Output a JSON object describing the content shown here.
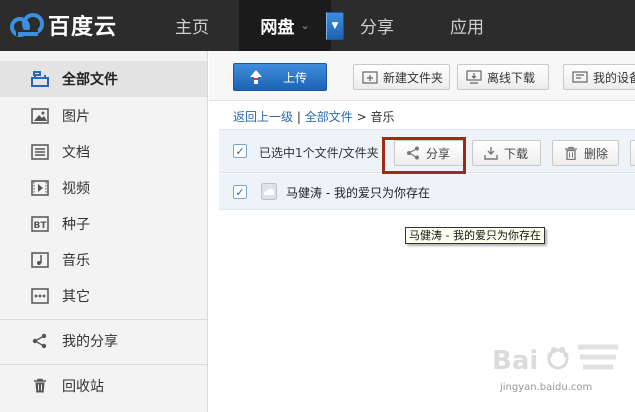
{
  "brand": {
    "name": "百度云"
  },
  "nav": [
    {
      "label": "主页",
      "active": false
    },
    {
      "label": "网盘",
      "active": true,
      "chevron": "chevron-down-icon"
    },
    {
      "label": "分享",
      "active": false
    },
    {
      "label": "应用",
      "active": false
    }
  ],
  "sidebar": {
    "items": [
      {
        "label": "全部文件",
        "icon": "folder-icon",
        "active": true
      },
      {
        "label": "图片",
        "icon": "image-icon"
      },
      {
        "label": "文档",
        "icon": "document-icon"
      },
      {
        "label": "视频",
        "icon": "video-icon"
      },
      {
        "label": "种子",
        "icon": "torrent-icon"
      },
      {
        "label": "音乐",
        "icon": "music-icon"
      },
      {
        "label": "其它",
        "icon": "more-icon"
      },
      {
        "label": "我的分享",
        "icon": "share-icon"
      },
      {
        "label": "回收站",
        "icon": "trash-icon"
      }
    ]
  },
  "toolbar": {
    "upload_label": "上传",
    "new_folder_label": "新建文件夹",
    "offline_download_label": "离线下载",
    "my_device_label": "我的设备"
  },
  "breadcrumb": {
    "back_label": "返回上一级",
    "separator": "|",
    "all_files_label": "全部文件",
    "arrow": ">",
    "current": "音乐"
  },
  "selection": {
    "checked": true,
    "text": "已选中1个文件/文件夹",
    "share_label": "分享",
    "download_label": "下载",
    "delete_label": "删除"
  },
  "files": [
    {
      "name": "马健涛 - 我的爱只为你存在",
      "checked": true
    }
  ],
  "tooltip": {
    "text": "马健涛 - 我的爱只为你存在"
  },
  "watermark": {
    "text": "jingyan.baidu.com"
  },
  "colors": {
    "accent": "#2b68b4",
    "highlight": "#a22a12",
    "topbar": "#2c2c2c"
  }
}
